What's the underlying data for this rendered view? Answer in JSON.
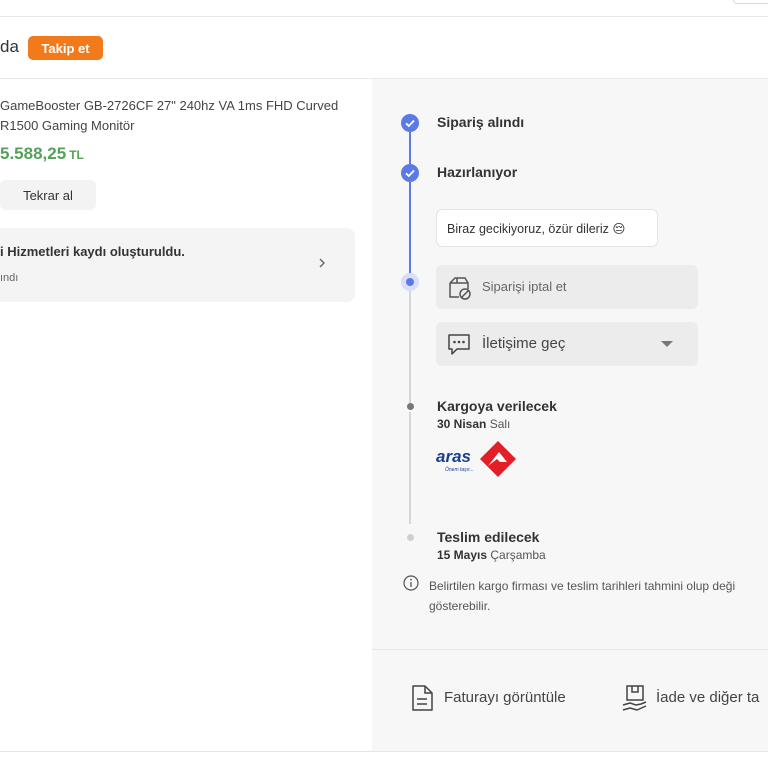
{
  "seller": {
    "name": "da",
    "follow_label": "Takip et",
    "follow_color": "#f27a1a"
  },
  "product": {
    "title": "GameBooster GB-2726CF 27\" 240hz VA 1ms FHD Curved R1500 Gaming Monitör",
    "price": "5.588,25",
    "currency": "TL",
    "reorder_label": "Tekrar al"
  },
  "service": {
    "title": "i Hizmetleri kaydı oluşturuldu.",
    "subtitle": "ındı"
  },
  "timeline": {
    "accent": "#5b7ae6",
    "steps": [
      {
        "title": "Sipariş alındı",
        "state": "done"
      },
      {
        "title": "Hazırlanıyor",
        "state": "current"
      },
      {
        "title": "Kargoya verilecek",
        "date_bold": "30 Nisan",
        "date_rest": " Salı",
        "state": "pending"
      },
      {
        "title": "Teslim edilecek",
        "date_bold": "15 Mayıs",
        "date_rest": " Çarşamba",
        "state": "pending"
      }
    ],
    "delay_message": "Biraz gecikiyoruz, özür dileriz 😔",
    "cancel_label": "Siparişi iptal et",
    "contact_label": "İletişime geç",
    "carrier_logo_text": "aras",
    "carrier_logo_tagline": "Önem taşır..."
  },
  "info": {
    "line1": "Belirtilen kargo firması ve teslim tarihleri tahmini olup deği",
    "line2": "gösterebilir."
  },
  "actions": {
    "invoice_label": "Faturayı görüntüle",
    "return_label": "İade ve diğer ta"
  }
}
